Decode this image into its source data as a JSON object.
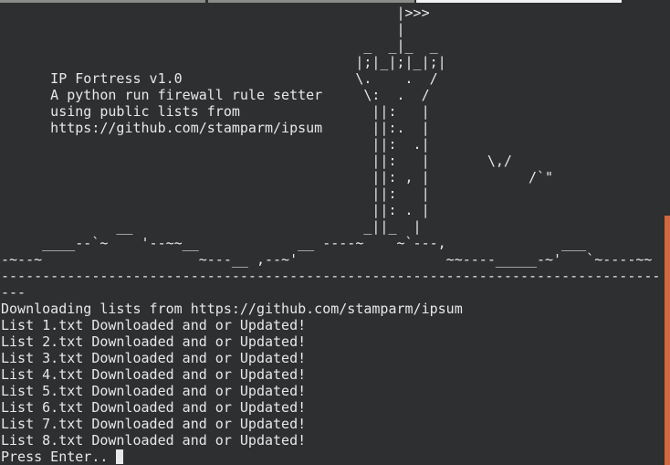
{
  "tabs": [
    {
      "label": ""
    },
    {
      "label": ""
    },
    {
      "label": ""
    }
  ],
  "terminal": {
    "banner_lines": [
      "                                                |>>>",
      "                                                |",
      "                                            _  _|_  _",
      "                                           |;|_|;|_|;|",
      "      IP Fortress v1.0                     \\.    .  /",
      "      A python run firewall rule setter     \\:  .  /",
      "      using public lists from                ||:   |",
      "      https://github.com/stamparm/ipsum      ||:.  |",
      "                                             ||:  .|",
      "                                             ||:   |       \\,/",
      "                                             ||: , |            /`\"",
      "                                             ||:   |",
      "                                             ||: . |",
      "              __                            _||_  |",
      "     ____--`~    '--~~__            __ ----~    ~`---,              ___",
      "-~--~                   ~---__ ,--~'                  ~~----_____-~'   `~----~~",
      "--------------------------------------------------------------------------------",
      "---"
    ],
    "output_lines": [
      "Downloading lists from https://github.com/stamparm/ipsum",
      "List 1.txt Downloaded and or Updated!",
      "List 2.txt Downloaded and or Updated!",
      "List 3.txt Downloaded and or Updated!",
      "List 4.txt Downloaded and or Updated!",
      "List 5.txt Downloaded and or Updated!",
      "List 6.txt Downloaded and or Updated!",
      "List 7.txt Downloaded and or Updated!",
      "List 8.txt Downloaded and or Updated!"
    ],
    "prompt": "Press Enter.. "
  },
  "colors": {
    "background": "#2d2f30",
    "text": "#e8e8e8",
    "scrollbar": "#d2683c"
  }
}
